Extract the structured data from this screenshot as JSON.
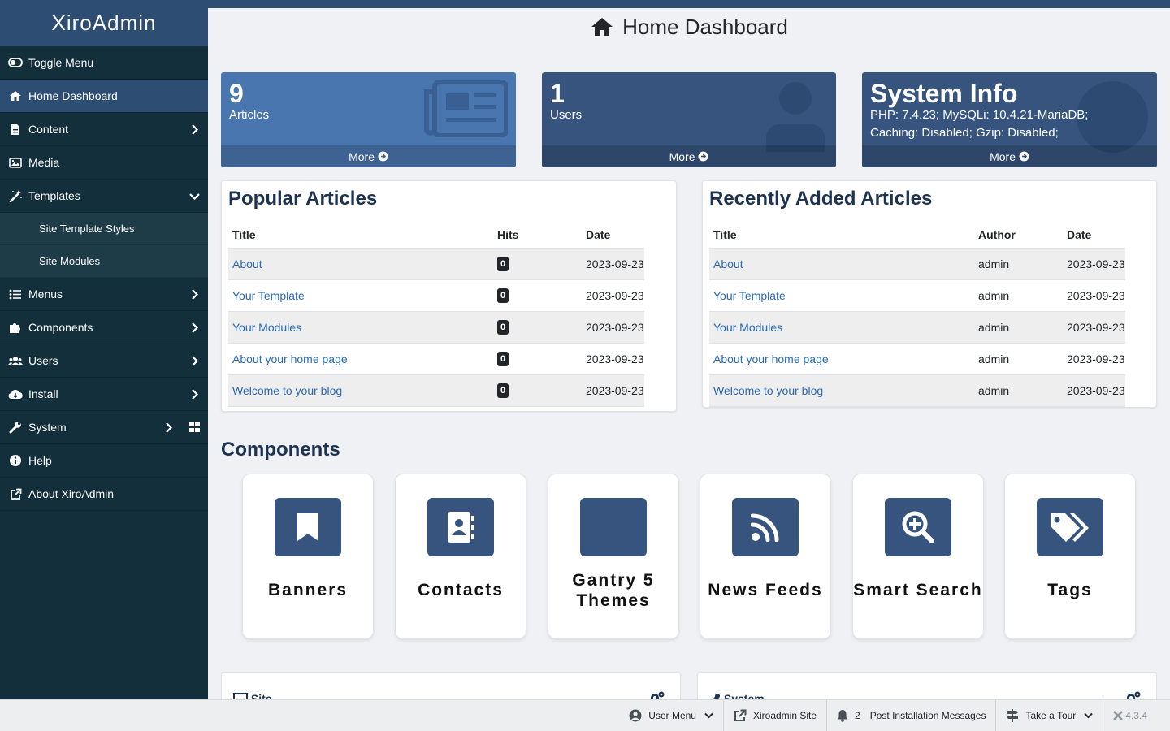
{
  "sidebar": {
    "brand": "XiroAdmin",
    "items": [
      {
        "label": "Toggle Menu"
      },
      {
        "label": "Home Dashboard"
      },
      {
        "label": "Content"
      },
      {
        "label": "Media"
      },
      {
        "label": "Templates"
      },
      {
        "label": "Site Template Styles"
      },
      {
        "label": "Site Modules"
      },
      {
        "label": "Menus"
      },
      {
        "label": "Components"
      },
      {
        "label": "Users"
      },
      {
        "label": "Install"
      },
      {
        "label": "System"
      },
      {
        "label": "Help"
      },
      {
        "label": "About XiroAdmin"
      }
    ]
  },
  "header": {
    "title": "Home Dashboard"
  },
  "stats": {
    "articles": {
      "number": "9",
      "label": "Articles",
      "more": "More"
    },
    "users": {
      "number": "1",
      "label": "Users",
      "more": "More"
    },
    "system": {
      "title": "System Info",
      "text": "PHP: 7.4.23; MySQLi: 10.4.21-MariaDB; Caching: Disabled; Gzip: Disabled;",
      "more": "More"
    }
  },
  "popular": {
    "title": "Popular Articles",
    "columns": [
      "Title",
      "Hits",
      "Date"
    ],
    "rows": [
      {
        "title": "About",
        "hits": "0",
        "date": "2023-09-23"
      },
      {
        "title": "Your Template",
        "hits": "0",
        "date": "2023-09-23"
      },
      {
        "title": "Your Modules",
        "hits": "0",
        "date": "2023-09-23"
      },
      {
        "title": "About your home page",
        "hits": "0",
        "date": "2023-09-23"
      },
      {
        "title": "Welcome to your blog",
        "hits": "0",
        "date": "2023-09-23"
      }
    ]
  },
  "recent": {
    "title": "Recently Added Articles",
    "columns": [
      "Title",
      "Author",
      "Date"
    ],
    "rows": [
      {
        "title": "About",
        "author": "admin",
        "date": "2023-09-23"
      },
      {
        "title": "Your Template",
        "author": "admin",
        "date": "2023-09-23"
      },
      {
        "title": "Your Modules",
        "author": "admin",
        "date": "2023-09-23"
      },
      {
        "title": "About your home page",
        "author": "admin",
        "date": "2023-09-23"
      },
      {
        "title": "Welcome to your blog",
        "author": "admin",
        "date": "2023-09-23"
      }
    ]
  },
  "components": {
    "title": "Components",
    "items": [
      {
        "label": "Banners",
        "icon": "bookmark-icon"
      },
      {
        "label": "Contacts",
        "icon": "address-book-icon"
      },
      {
        "label": "Gantry 5 Themes",
        "icon": "blank-tile"
      },
      {
        "label": "News Feeds",
        "icon": "rss-icon"
      },
      {
        "label": "Smart Search",
        "icon": "search-plus-icon"
      },
      {
        "label": "Tags",
        "icon": "tags-icon"
      }
    ]
  },
  "lower": {
    "site": "Site",
    "system": "System"
  },
  "statusbar": {
    "user_menu": "User Menu",
    "site": "Xiroadmin Site",
    "notifications_count": "2",
    "post_install": "Post Installation Messages",
    "tour": "Take a Tour",
    "version": "4.3.4"
  },
  "colors": {
    "sidebar_bg": "#132f3b",
    "brand_bg": "#2d4d73",
    "stat_articles": "#4a76b0",
    "stat_users": "#36547e",
    "link": "#2a69b8"
  }
}
